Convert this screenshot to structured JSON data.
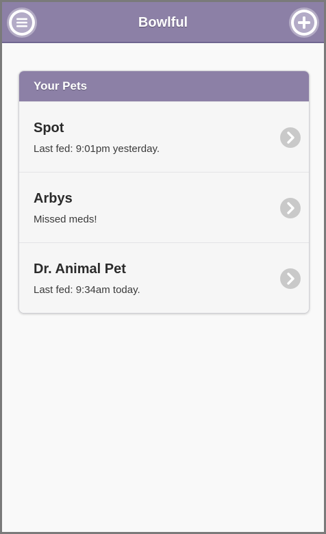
{
  "header": {
    "title": "Bowlful",
    "menu_icon": "hamburger-menu-icon",
    "add_icon": "plus-circle-icon",
    "color": "#8c80a6"
  },
  "pets_card": {
    "title": "Your Pets",
    "items": [
      {
        "name": "Spot",
        "status": "Last fed: 9:01pm yesterday."
      },
      {
        "name": "Arbys",
        "status": "Missed meds!"
      },
      {
        "name": "Dr. Animal Pet",
        "status": "Last fed: 9:34am today."
      }
    ],
    "chevron_icon": "chevron-right-icon"
  }
}
